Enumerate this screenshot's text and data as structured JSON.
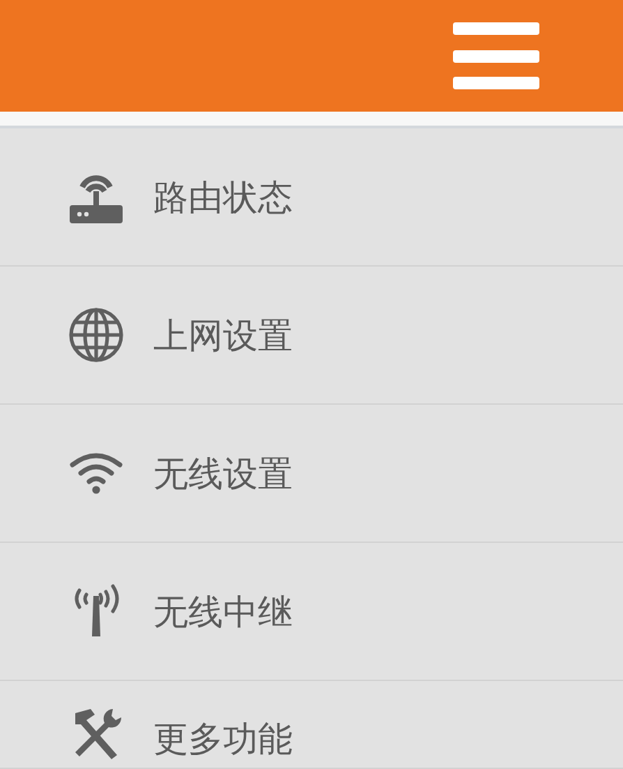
{
  "menu_items": [
    {
      "kind": "router",
      "label": "路由状态"
    },
    {
      "kind": "globe",
      "label": "上网设置"
    },
    {
      "kind": "wifi",
      "label": "无线设置"
    },
    {
      "kind": "antenna",
      "label": "无线中继"
    },
    {
      "kind": "tools",
      "label": "更多功能"
    }
  ]
}
